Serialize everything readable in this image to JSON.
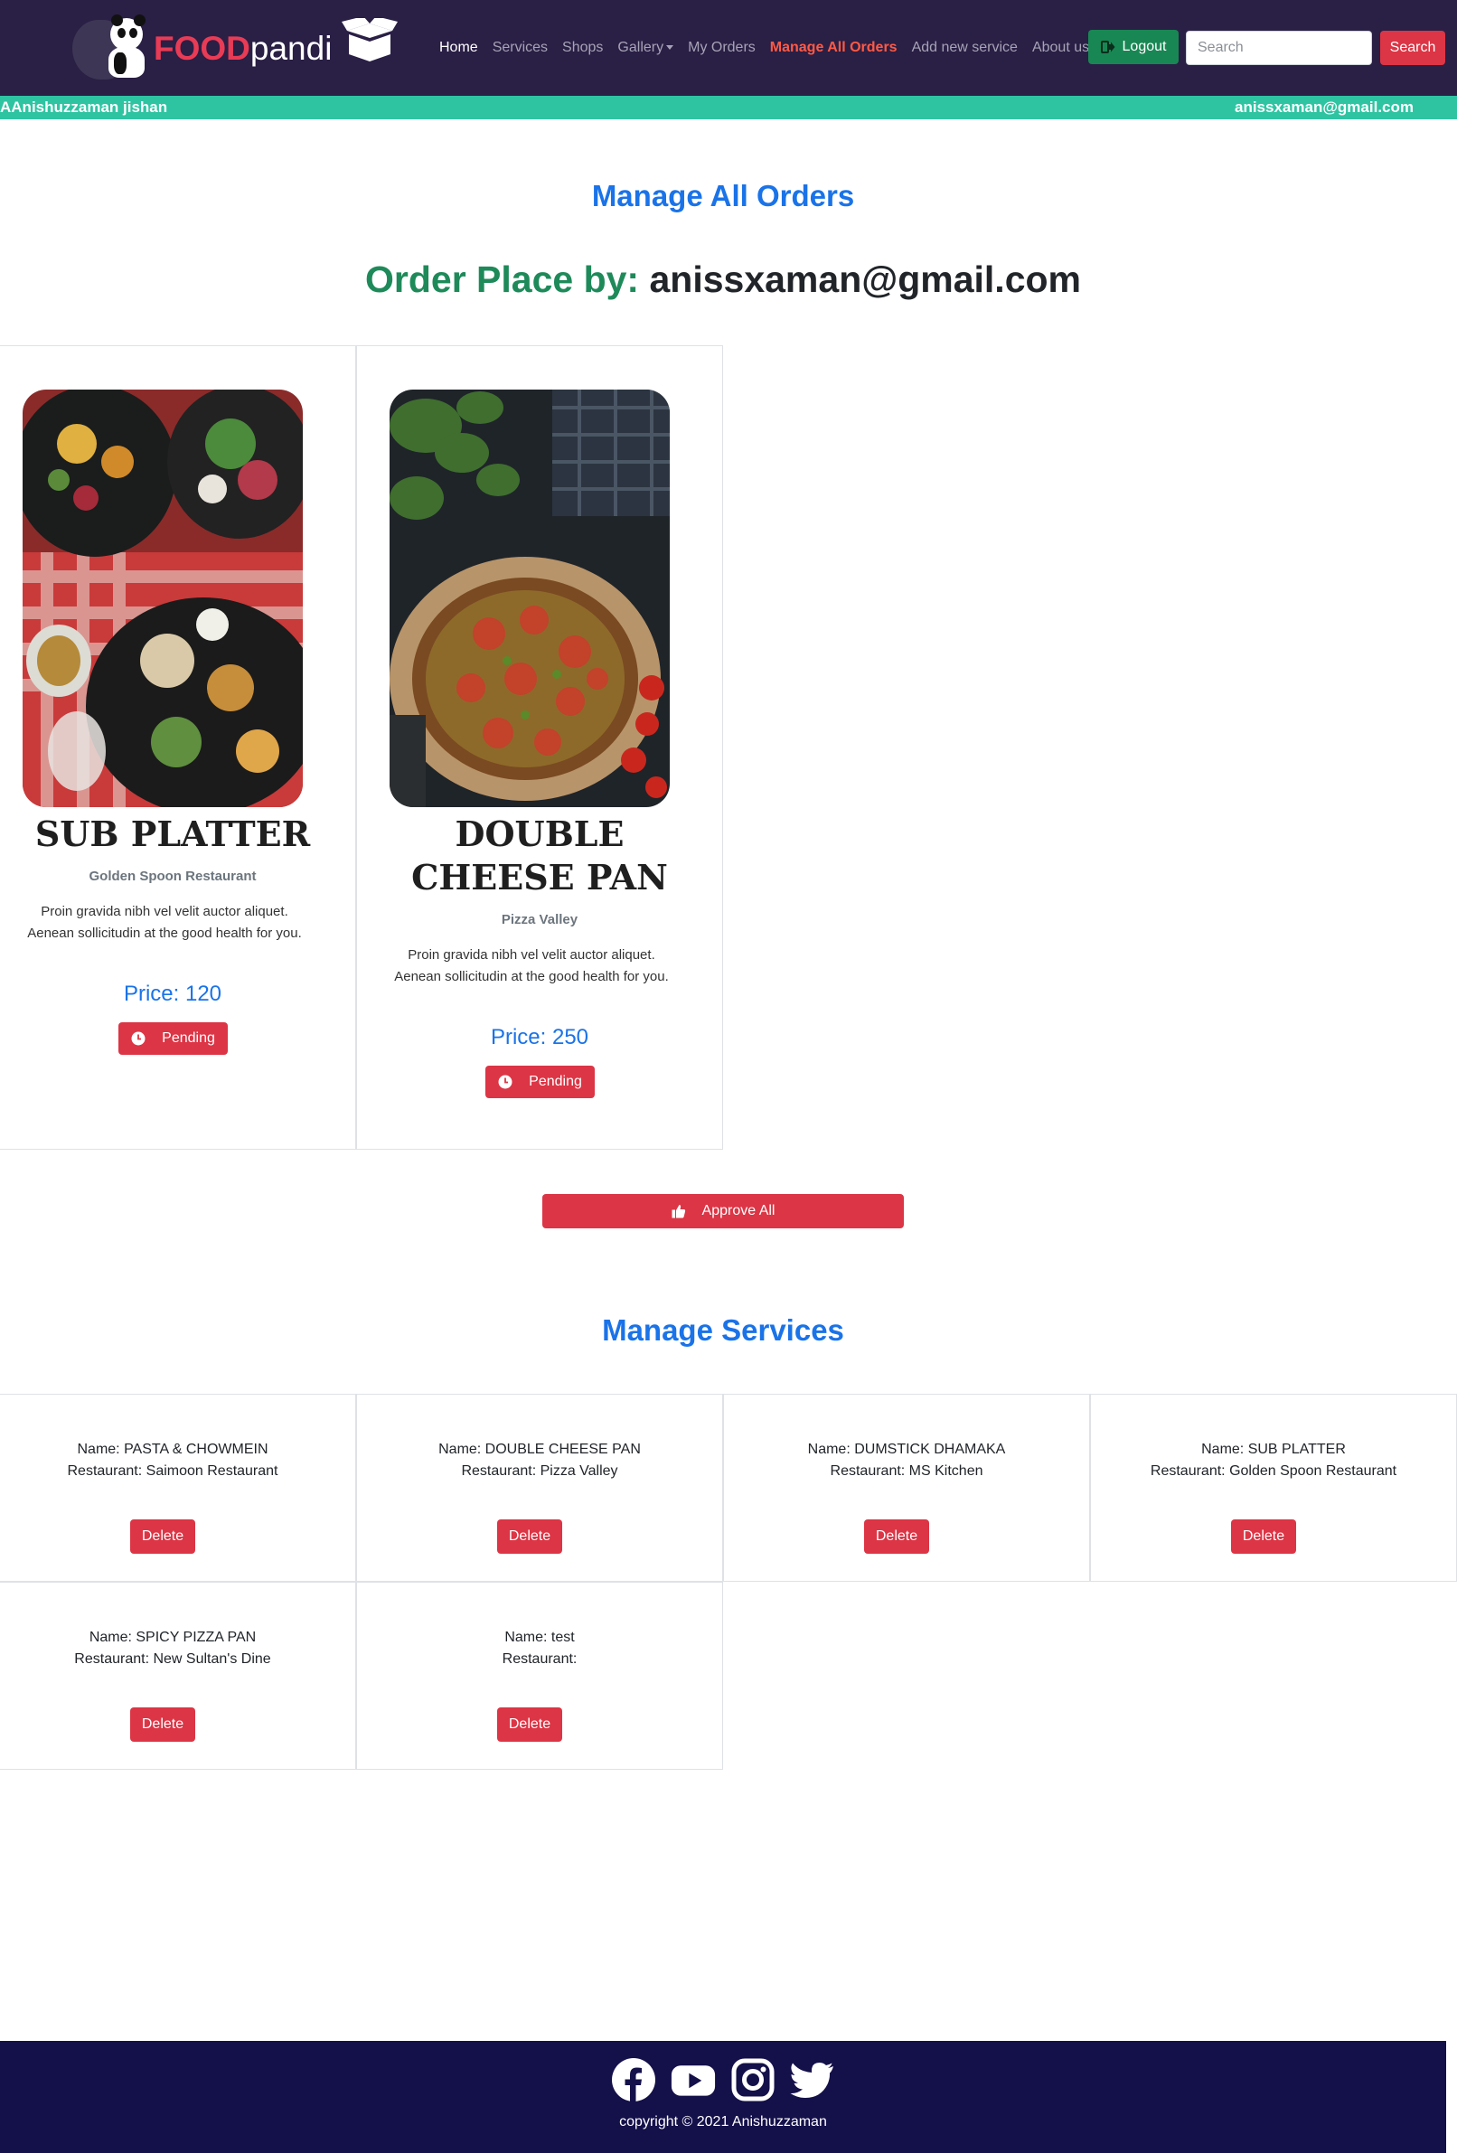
{
  "brand": {
    "part1": "FOOD",
    "part2": "pandi"
  },
  "nav": {
    "home": "Home",
    "services": "Services",
    "shops": "Shops",
    "gallery": "Gallery",
    "my_orders": "My Orders",
    "manage_all_orders": "Manage All Orders",
    "add_new_service": "Add new service",
    "about_us": "About us",
    "logout": "Logout",
    "search_placeholder": "Search",
    "search_button": "Search"
  },
  "user": {
    "name": "AAnishuzzaman jishan",
    "email": "anissxaman@gmail.com"
  },
  "orders_section": {
    "heading": "Manage All Orders",
    "order_place_label": "Order Place by:",
    "order_place_email": "anissxaman@gmail.com",
    "orders": [
      {
        "title": "SUB PLATTER",
        "restaurant": "Golden Spoon Restaurant",
        "description": "Proin gravida nibh vel velit auctor aliquet. Aenean sollicitudin at the good health for you.",
        "price": "Price: 120",
        "status": "Pending"
      },
      {
        "title": "DOUBLE CHEESE PAN",
        "restaurant": "Pizza Valley",
        "description": "Proin gravida nibh vel velit auctor aliquet. Aenean sollicitudin at the good health for you.",
        "price": "Price: 250",
        "status": "Pending"
      }
    ],
    "approve_all": "Approve All"
  },
  "services_section": {
    "heading": "Manage Services",
    "services": [
      {
        "name": "Name: PASTA & CHOWMEIN",
        "restaurant": "Restaurant: Saimoon Restaurant",
        "delete": "Delete"
      },
      {
        "name": "Name: DOUBLE CHEESE PAN",
        "restaurant": "Restaurant: Pizza Valley",
        "delete": "Delete"
      },
      {
        "name": "Name: DUMSTICK DHAMAKA",
        "restaurant": "Restaurant: MS Kitchen",
        "delete": "Delete"
      },
      {
        "name": "Name: SUB PLATTER",
        "restaurant": "Restaurant: Golden Spoon Restaurant",
        "delete": "Delete"
      },
      {
        "name": "Name: SPICY PIZZA PAN",
        "restaurant": "Restaurant: New Sultan's Dine",
        "delete": "Delete"
      },
      {
        "name": "Name: test",
        "restaurant": "Restaurant:",
        "delete": "Delete"
      }
    ]
  },
  "footer": {
    "icons": [
      "facebook-icon",
      "youtube-icon",
      "instagram-icon",
      "twitter-icon"
    ],
    "copyright": "copyright © 2021 Anishuzzaman"
  },
  "colors": {
    "navbar_bg": "#2a1f45",
    "userbar_bg": "#2ec4a2",
    "accent_blue": "#1a73e8",
    "danger": "#dc3545",
    "success": "#198754",
    "active_link": "#ff5a45",
    "footer_bg": "#14104a"
  }
}
